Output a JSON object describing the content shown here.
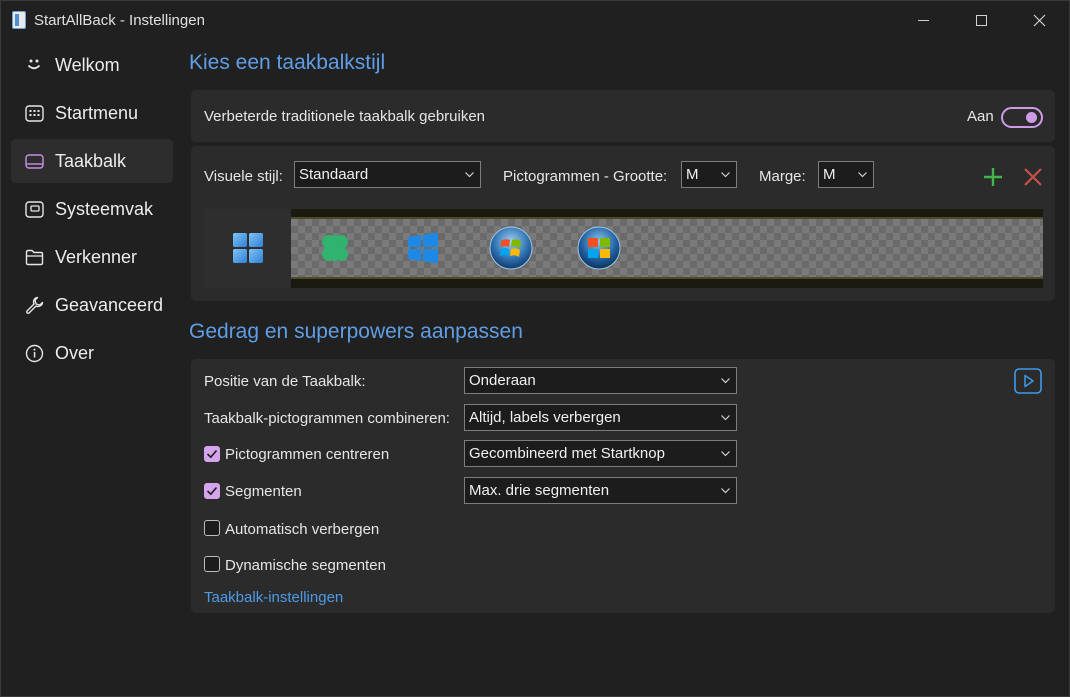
{
  "window": {
    "title": "StartAllBack - Instellingen"
  },
  "sidebar": {
    "items": [
      {
        "label": "Welkom",
        "icon": "smile-icon"
      },
      {
        "label": "Startmenu",
        "icon": "start-menu-icon"
      },
      {
        "label": "Taakbalk",
        "icon": "taskbar-icon",
        "active": true
      },
      {
        "label": "Systeemvak",
        "icon": "system-tray-icon"
      },
      {
        "label": "Verkenner",
        "icon": "folder-icon"
      },
      {
        "label": "Geavanceerd",
        "icon": "wrench-icon"
      },
      {
        "label": "Over",
        "icon": "info-icon"
      }
    ]
  },
  "style_section": {
    "title": "Kies een taakbalkstijl",
    "enhanced_label": "Verbeterde traditionele taakbalk gebruiken",
    "toggle_state": "Aan",
    "visual_style_label": "Visuele stijl:",
    "visual_style_value": "Standaard",
    "icon_size_label": "Pictogrammen - Grootte:",
    "icon_size_value": "M",
    "margin_label": "Marge:",
    "margin_value": "M",
    "styles": [
      "windows-11",
      "windows-10-clover",
      "windows-10",
      "windows-7",
      "windows-vista"
    ]
  },
  "behavior_section": {
    "title": "Gedrag en superpowers aanpassen",
    "position_label": "Positie van de Taakbalk:",
    "position_value": "Onderaan",
    "combine_label": "Taakbalk-pictogrammen combineren:",
    "combine_value": "Altijd, labels verbergen",
    "center_label": "Pictogrammen centreren",
    "center_checked": true,
    "center_value": "Gecombineerd met Startknop",
    "segments_label": "Segmenten",
    "segments_checked": true,
    "segments_value": "Max. drie segmenten",
    "autohide_label": "Automatisch verbergen",
    "autohide_checked": false,
    "dynamic_label": "Dynamische segmenten",
    "dynamic_checked": false,
    "settings_link": "Taakbalk-instellingen"
  },
  "colors": {
    "accent": "#5f9ee6",
    "toggle": "#d09be6",
    "link": "#4d9be8",
    "add": "#3fb54a",
    "remove": "#c9504a"
  }
}
